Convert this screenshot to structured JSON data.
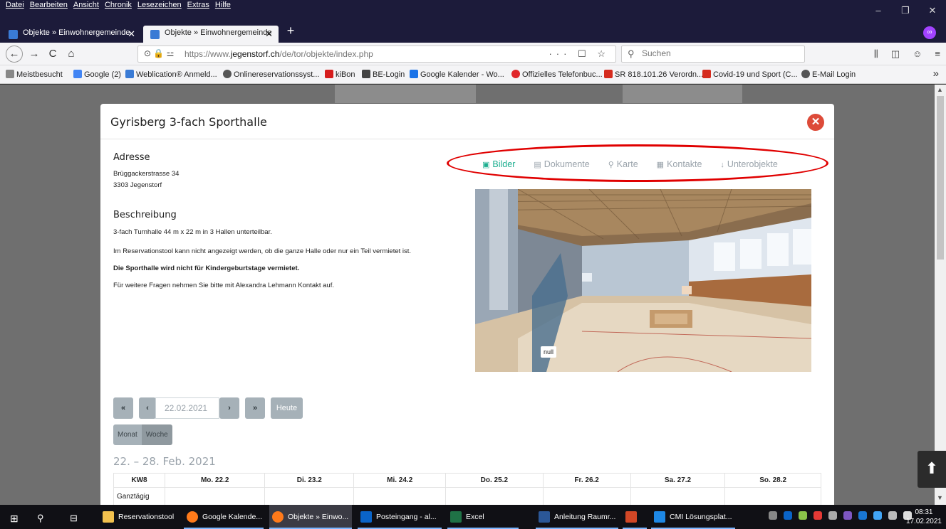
{
  "menu": [
    "Datei",
    "Bearbeiten",
    "Ansicht",
    "Chronik",
    "Lesezeichen",
    "Extras",
    "Hilfe"
  ],
  "window_controls": [
    "–",
    "❐",
    "✕"
  ],
  "tabs": [
    {
      "label": "Objekte » Einwohnergemeinde",
      "active": false
    },
    {
      "label": "Objekte » Einwohnergemeinde",
      "active": true
    }
  ],
  "new_tab": "+",
  "nav": {
    "back": "←",
    "forward": "→",
    "reload": "C",
    "home": "⌂",
    "url_prefix": "https://www.",
    "url_domain": "jegenstorf.ch",
    "url_path": "/de/tor/objekte/index.php",
    "url_icons": "⊙ 🔒 ⚍",
    "url_right": "··· ☐ ☆",
    "search_placeholder": "Suchen",
    "right_icons": [
      "⫼",
      "◫",
      "☺",
      "≡"
    ]
  },
  "bookmarks": [
    {
      "label": "Meistbesucht",
      "color": "#888"
    },
    {
      "label": "Google (2)",
      "color": "#4285f4"
    },
    {
      "label": "Weblication® Anmeld...",
      "color": "#3a7bd5"
    },
    {
      "label": "Onlinereservationssyst...",
      "color": "#555"
    },
    {
      "label": "kiBon",
      "color": "#d61d1d"
    },
    {
      "label": "BE-Login",
      "color": "#444"
    },
    {
      "label": "Google Kalender - Wo...",
      "color": "#1a73e8"
    },
    {
      "label": "Offizielles Telefonbuc...",
      "color": "#e0262a"
    },
    {
      "label": "SR 818.101.26 Verordn...",
      "color": "#d52b1e"
    },
    {
      "label": "Covid-19 und Sport (C...",
      "color": "#d52b1e"
    },
    {
      "label": "E-Mail Login",
      "color": "#555"
    }
  ],
  "bookmarks_more": "»",
  "modal": {
    "title": "Gyrisberg 3-fach Sporthalle",
    "close": "✕",
    "address_heading": "Adresse",
    "address_line1": "Brüggackerstrasse 34",
    "address_line2": "3303 Jegenstorf",
    "description_heading": "Beschreibung",
    "desc1": "3-fach Turnhalle 44 m x 22 m in 3 Hallen unterteilbar.",
    "desc2": "Im Reservationstool kann nicht angezeigt werden, ob die ganze Halle oder nur ein Teil vermietet ist.",
    "desc3": "Die Sporthalle wird nicht für Kindergeburtstage vermietet.",
    "desc4": "Für weitere Fragen nehmen Sie bitte  mit Alexandra Lehmann Kontakt auf.",
    "tabs": [
      {
        "label": "Bilder",
        "icon": "▣"
      },
      {
        "label": "Dokumente",
        "icon": "▤"
      },
      {
        "label": "Karte",
        "icon": "⚲"
      },
      {
        "label": "Kontakte",
        "icon": "▦"
      },
      {
        "label": "Unterobjekte",
        "icon": "↓"
      }
    ],
    "image_caption": "null"
  },
  "calendar": {
    "first": "«",
    "prev": "‹",
    "date": "22.02.2021",
    "next": "›",
    "last": "»",
    "today": "Heute",
    "view_month": "Monat",
    "view_week": "Woche",
    "range": "22. – 28. Feb. 2021",
    "headers": [
      "KW8",
      "Mo. 22.2",
      "Di. 23.2",
      "Mi. 24.2",
      "Do. 25.2",
      "Fr. 26.2",
      "Sa. 27.2",
      "So. 28.2"
    ],
    "row_label": "Ganztägig"
  },
  "scroll_top": "⬆",
  "taskbar": {
    "items": [
      {
        "label": "Reservationstool",
        "color": "#f2c14e"
      },
      {
        "label": "Google Kalende...",
        "color": "#ff7a1a"
      },
      {
        "label": "Objekte » Einwo...",
        "color": "#ff7a1a"
      },
      {
        "label": "Posteingang - al...",
        "color": "#0a64c8"
      },
      {
        "label": "Excel",
        "color": "#1f7246"
      },
      {
        "label": "Anleitung Raumr...",
        "color": "#2b5797"
      },
      {
        "label": "",
        "color": "#d24726"
      },
      {
        "label": "CMI Lösungsplat...",
        "color": "#1e88e5"
      }
    ],
    "time": "08:31",
    "date": "17.02.2021"
  }
}
